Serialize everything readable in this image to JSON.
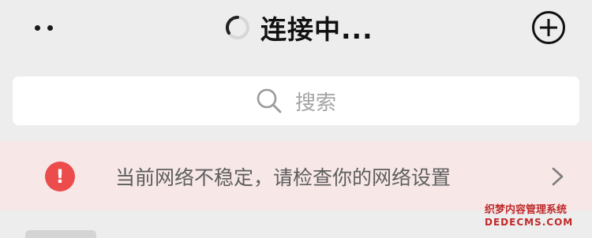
{
  "header": {
    "title": "连接中...",
    "more_icon": "more-dots-icon",
    "loading_icon": "spinner-icon",
    "add_icon": "plus-circle-icon"
  },
  "search": {
    "placeholder": "搜索",
    "icon": "search-icon"
  },
  "banner": {
    "text": "当前网络不稳定，请检查你的网络设置",
    "icon": "warning-icon",
    "chevron_icon": "chevron-right-icon",
    "background_color": "#f7e7e7",
    "icon_color": "#ec4c4c"
  },
  "watermark": {
    "line1": "织梦内容管理系统",
    "line2": "DEDECMS.COM"
  }
}
